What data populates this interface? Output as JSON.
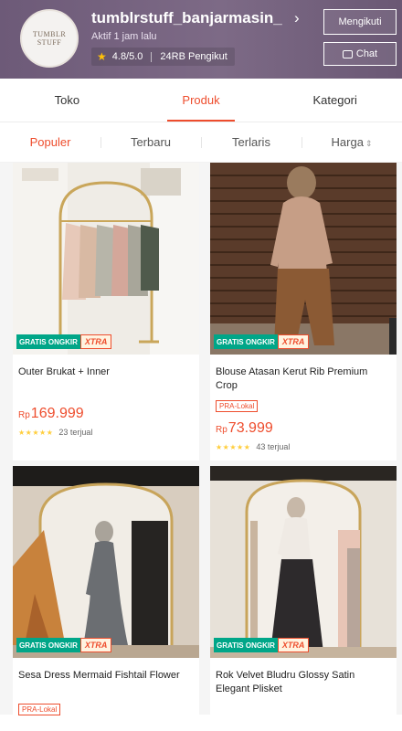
{
  "shop": {
    "logo_text": "TUMBLR\nSTUFF",
    "name": "tumblrstuff_banjarmasin_",
    "active": "Aktif 1 jam lalu",
    "rating": "4.8/5.0",
    "followers": "24RB Pengikut",
    "follow_label": "Mengikuti",
    "chat_label": "Chat"
  },
  "tabs": [
    {
      "label": "Toko"
    },
    {
      "label": "Produk"
    },
    {
      "label": "Kategori"
    }
  ],
  "sort": [
    {
      "label": "Populer"
    },
    {
      "label": "Terbaru"
    },
    {
      "label": "Terlaris"
    },
    {
      "label": "Harga"
    }
  ],
  "products": [
    {
      "title": "Outer Brukat + Inner",
      "tag": "",
      "currency": "Rp",
      "price": "169.999",
      "sold": "23 terjual"
    },
    {
      "title": "Blouse Atasan Kerut Rib Premium Crop",
      "tag": "PRA-Lokal",
      "currency": "Rp",
      "price": "73.999",
      "sold": "43 terjual"
    },
    {
      "title": "Sesa Dress Mermaid Fishtail Flower",
      "tag": "PRA-Lokal",
      "currency": "",
      "price": "",
      "sold": ""
    },
    {
      "title": "Rok Velvet Bludru Glossy Satin Elegant Plisket",
      "tag": "",
      "currency": "",
      "price": "",
      "sold": ""
    }
  ],
  "badge": {
    "a": "GRATIS ONGKIR",
    "b": "XTRA"
  },
  "colors": {
    "accent": "#ee4d2d",
    "header": "#75627f",
    "star": "#ffce3d"
  }
}
